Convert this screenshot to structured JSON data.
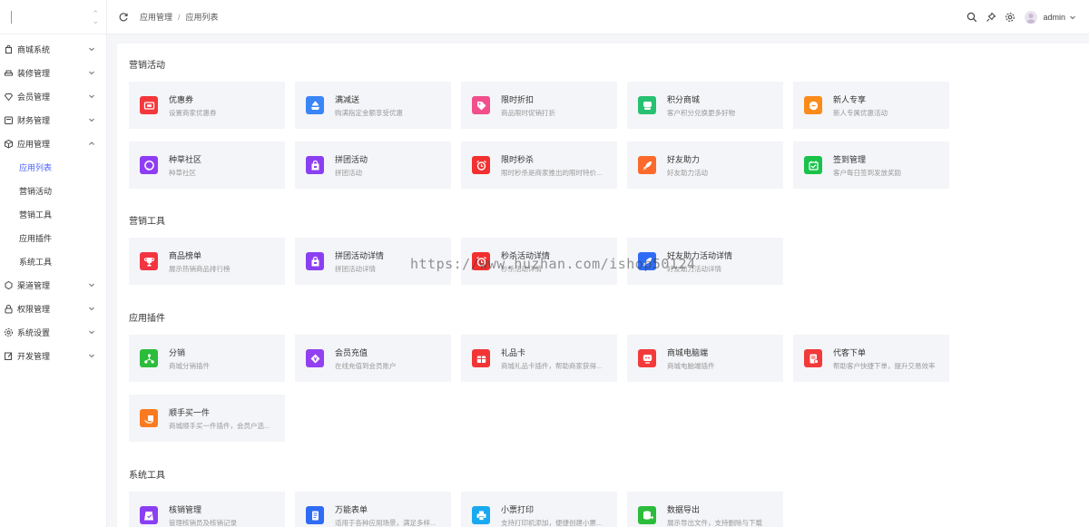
{
  "sidebar": {
    "items": [
      {
        "label": "商城系统",
        "icon": "bag-icon"
      },
      {
        "label": "装修管理",
        "icon": "brush-icon"
      },
      {
        "label": "会员管理",
        "icon": "diamond-icon"
      },
      {
        "label": "财务管理",
        "icon": "finance-icon"
      },
      {
        "label": "应用管理",
        "icon": "cube-icon"
      },
      {
        "label": "渠道管理",
        "icon": "channel-icon"
      },
      {
        "label": "权限管理",
        "icon": "lock-icon"
      },
      {
        "label": "系统设置",
        "icon": "gear-icon"
      },
      {
        "label": "开发管理",
        "icon": "edit-icon"
      }
    ],
    "sub_items": [
      "应用列表",
      "营销活动",
      "营销工具",
      "应用插件",
      "系统工具"
    ],
    "active_sub": "应用列表"
  },
  "header": {
    "breadcrumb": [
      "应用管理",
      "应用列表"
    ],
    "separator": "/",
    "user": "admin"
  },
  "sections": [
    {
      "title": "营销活动",
      "cards": [
        {
          "name": "优惠券",
          "desc": "设置商家优惠券",
          "color": "#f5373b",
          "icon": "coupon-icon"
        },
        {
          "name": "满减送",
          "desc": "购满指定金额享受优惠",
          "color": "#3a86f7",
          "icon": "discount-icon"
        },
        {
          "name": "限时折扣",
          "desc": "商品限时促销打折",
          "color": "#f04f8c",
          "icon": "tag-icon"
        },
        {
          "name": "积分商城",
          "desc": "客户积分兑换更多好物",
          "color": "#27c171",
          "icon": "points-store-icon"
        },
        {
          "name": "新人专享",
          "desc": "新人专属优惠活动",
          "color": "#fb8b1a",
          "icon": "new-user-icon"
        },
        {
          "name": "种草社区",
          "desc": "种草社区",
          "color": "#8f3df5",
          "icon": "chat-heart-icon"
        },
        {
          "name": "拼团活动",
          "desc": "拼团活动",
          "color": "#8b3ff2",
          "icon": "group-bag-icon"
        },
        {
          "name": "限时秒杀",
          "desc": "限时秒杀是商家推出的限时特价...",
          "color": "#f23030",
          "icon": "alarm-clock-icon"
        },
        {
          "name": "好友助力",
          "desc": "好友助力活动",
          "color": "#fb6a2c",
          "icon": "rocket-icon"
        },
        {
          "name": "签到管理",
          "desc": "客户每日签到发放奖励",
          "color": "#19c24a",
          "icon": "calendar-check-icon"
        }
      ]
    },
    {
      "title": "营销工具",
      "cards": [
        {
          "name": "商品榜单",
          "desc": "展示热销商品排行榜",
          "color": "#f23540",
          "icon": "trophy-icon"
        },
        {
          "name": "拼团活动详情",
          "desc": "拼团活动详情",
          "color": "#8b3ff2",
          "icon": "group-bag-icon"
        },
        {
          "name": "秒杀活动详情",
          "desc": "秒杀活动详情",
          "color": "#f23030",
          "icon": "alarm-clock-icon"
        },
        {
          "name": "好友助力活动详情",
          "desc": "好友助力活动详情",
          "color": "#2f6cf5",
          "icon": "rocket-icon"
        }
      ]
    },
    {
      "title": "应用插件",
      "cards": [
        {
          "name": "分销",
          "desc": "商城分销插件",
          "color": "#2cbc3b",
          "icon": "distribution-icon"
        },
        {
          "name": "会员充值",
          "desc": "在线充值到会员账户",
          "color": "#9340f2",
          "icon": "yen-diamond-icon"
        },
        {
          "name": "礼品卡",
          "desc": "商城礼品卡插件，帮助商家获得...",
          "color": "#f23535",
          "icon": "gift-card-icon"
        },
        {
          "name": "商城电脑端",
          "desc": "商城电脑端插件",
          "color": "#f23a3a",
          "icon": "pc-store-icon"
        },
        {
          "name": "代客下单",
          "desc": "帮助客户快捷下单，提升交易效率",
          "color": "#f23a3a",
          "icon": "order-icon"
        },
        {
          "name": "顺手买一件",
          "desc": "商城顺手买一件插件，会员户选...",
          "color": "#fb7a1f",
          "icon": "hand-bag-icon"
        }
      ]
    },
    {
      "title": "系统工具",
      "cards": [
        {
          "name": "核销管理",
          "desc": "管理核销员及核销记录",
          "color": "#8b3ff2",
          "icon": "verify-icon"
        },
        {
          "name": "万能表单",
          "desc": "适用于各种应用场景，满足多样...",
          "color": "#2f6cf5",
          "icon": "form-icon"
        },
        {
          "name": "小票打印",
          "desc": "支持打印机添加，便捷创建小票...",
          "color": "#1aa9f0",
          "icon": "printer-icon"
        },
        {
          "name": "数据导出",
          "desc": "展示导出文件，支持删除与下载",
          "color": "#2cbc3b",
          "icon": "export-icon"
        }
      ]
    }
  ],
  "watermark": "https://www.huzhan.com/ishop50124"
}
